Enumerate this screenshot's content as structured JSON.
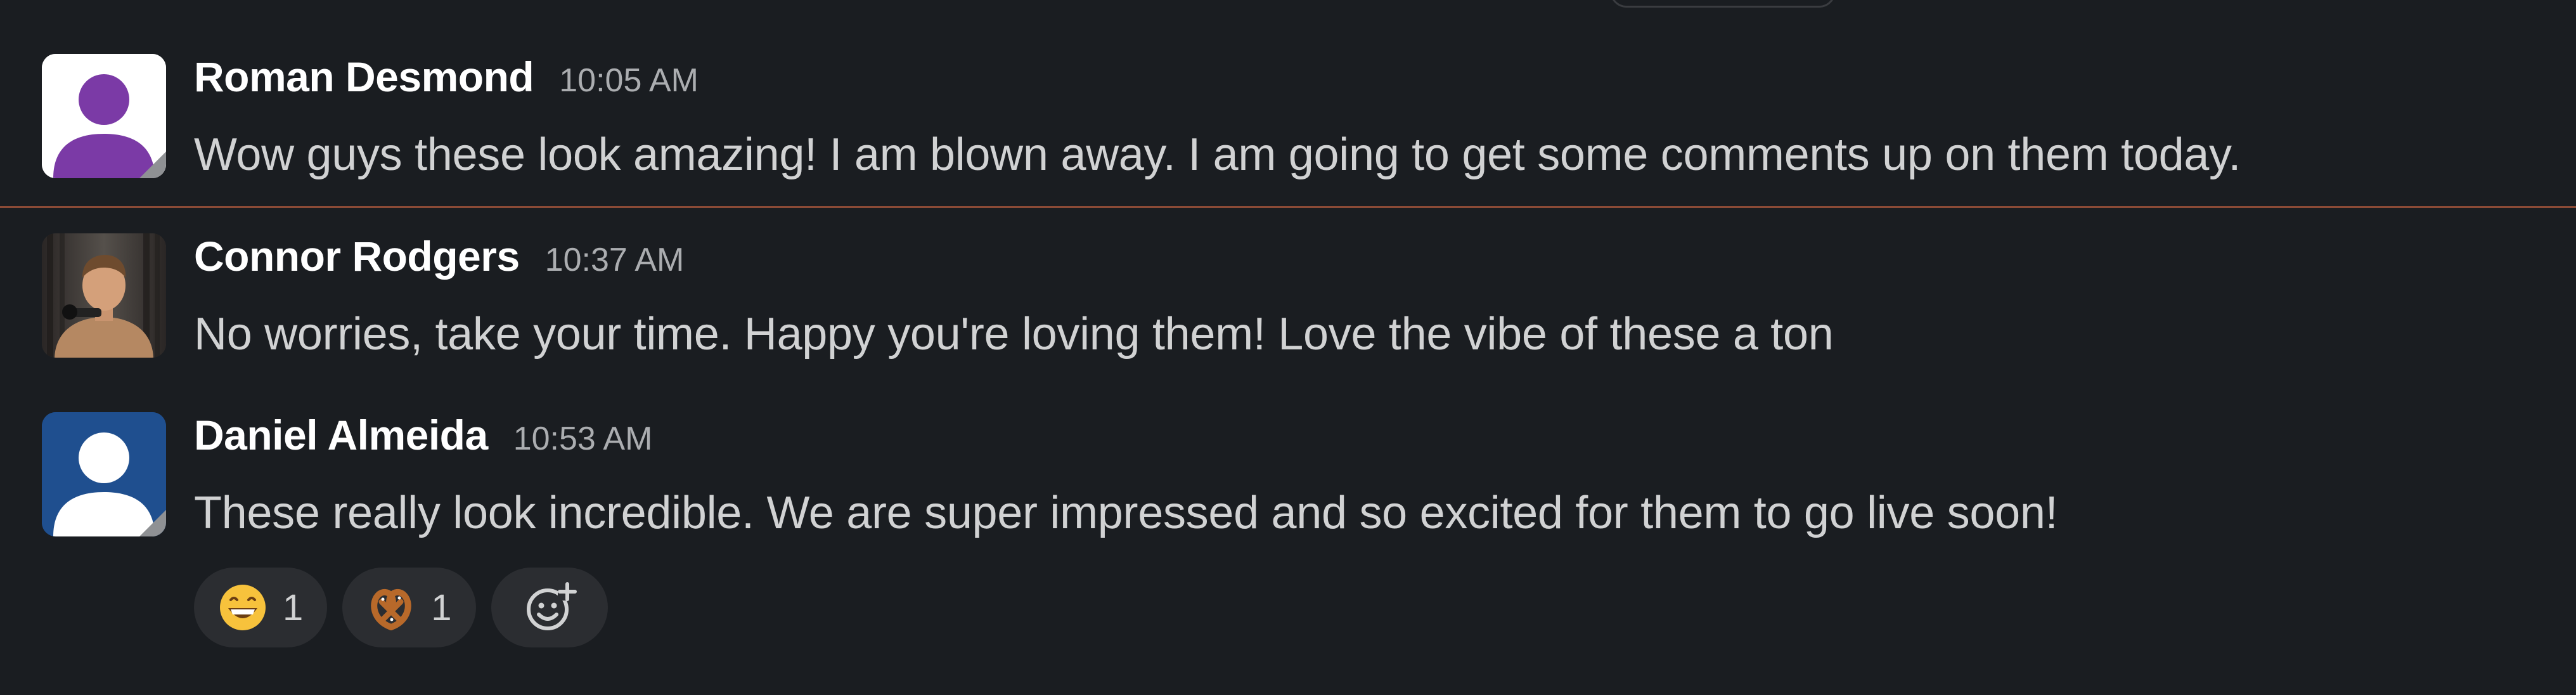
{
  "messages": [
    {
      "author": "Roman Desmond",
      "time": "10:05 AM",
      "text": "Wow guys these look amazing! I am blown away. I am going to get some comments up on them today.",
      "avatar": {
        "type": "default-user-icon",
        "color": "#7b3aa6"
      }
    },
    {
      "author": "Connor Rodgers",
      "time": "10:37 AM",
      "text": "No worries, take your time. Happy you're loving them! Love the vibe of these a ton",
      "avatar": {
        "type": "photo"
      }
    },
    {
      "author": "Daniel Almeida",
      "time": "10:53 AM",
      "text": "These really look incredible. We are super impressed and so excited for them to go live soon!",
      "avatar": {
        "type": "default-user-icon",
        "color": "#1f4f8f"
      }
    }
  ],
  "reactions": [
    {
      "emoji": "grinning-face",
      "count": "1"
    },
    {
      "emoji": "pretzel",
      "count": "1"
    }
  ],
  "add_reaction_icon": "add-emoji-icon",
  "colors": {
    "background": "#1a1d21",
    "new_messages_divider": "#8a4a36",
    "reaction_pill": "#2b2d31"
  }
}
